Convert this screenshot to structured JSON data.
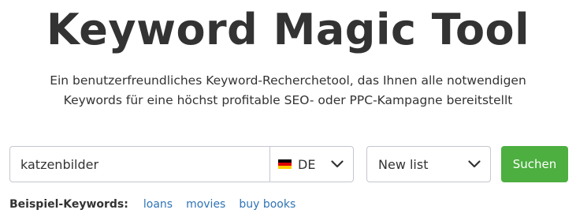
{
  "header": {
    "title": "Keyword Magic Tool",
    "subtitle_line1": "Ein benutzerfreundliches Keyword-Recherchetool, das Ihnen alle notwendigen",
    "subtitle_line2": "Keywords für eine höchst profitable SEO- oder PPC-Kampagne bereitstellt"
  },
  "search": {
    "value": "katzenbilder",
    "placeholder": "",
    "database": {
      "selected": "DE",
      "flag_icon": "germany-flag-icon",
      "flag_colors": [
        "#000000",
        "#dd0000",
        "#ffce00"
      ]
    },
    "list": {
      "selected": "New list"
    },
    "button_label": "Suchen"
  },
  "examples": {
    "label": "Beispiel-Keywords:",
    "keywords": [
      "loans",
      "movies",
      "buy books"
    ]
  },
  "colors": {
    "accent": "#4caf3f",
    "link": "#2f74b5",
    "text": "#333333",
    "border": "#c4c7cf"
  }
}
